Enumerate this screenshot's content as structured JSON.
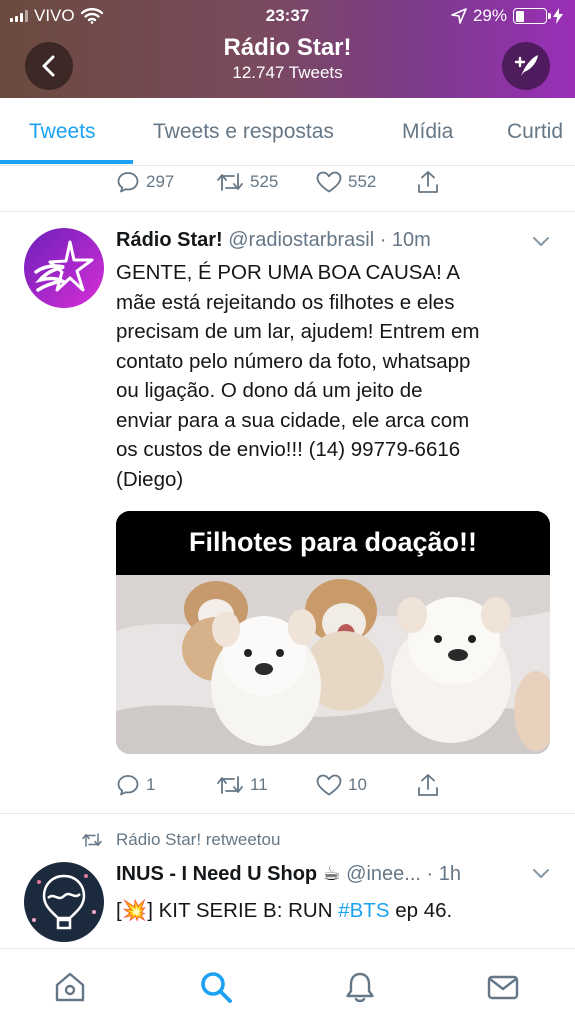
{
  "status": {
    "carrier": "VIVO",
    "time": "23:37",
    "battery": "29%"
  },
  "header": {
    "title": "Rádio Star!",
    "subtitle": "12.747 Tweets"
  },
  "tabs": [
    {
      "label": "Tweets"
    },
    {
      "label": "Tweets e respostas"
    },
    {
      "label": "Mídia"
    },
    {
      "label": "Curtid"
    }
  ],
  "prev_tweet": {
    "replies": "297",
    "retweets": "525",
    "likes": "552"
  },
  "tweet": {
    "name": "Rádio Star!",
    "meta": "@radiostarbrasil · 10m",
    "text_lines": [
      "GENTE, É POR UMA BOA CAUSA! A",
      "mãe está rejeitando os filhotes e eles",
      "precisam de um lar, ajudem! Entrem em",
      "contato pelo número da foto, whatsapp",
      "ou ligação. O dono dá um jeito de",
      "enviar para a sua cidade, ele arca com",
      "os custos de envio!!! (14) 99779-6616",
      "(Diego)"
    ],
    "image_caption": "Filhotes para doação!!",
    "replies": "1",
    "retweets": "11",
    "likes": "10"
  },
  "retweet": {
    "retweeted_by": "Rádio Star! retweetou",
    "name": "INUS - I Need U Shop ☕",
    "meta": "@inee... · 1h",
    "text_prefix": "[💥] KIT SERIE B: RUN ",
    "hashtag": "#BTS",
    "text_suffix": " ep 46."
  },
  "colors": {
    "accent": "#1da1f2",
    "muted": "#657786",
    "header_gradient_end": "#9a2fb8"
  },
  "icons": [
    "back-icon",
    "compose-icon",
    "reply-icon",
    "retweet-icon",
    "like-icon",
    "share-icon",
    "chevron-down-icon",
    "home-icon",
    "search-icon",
    "bell-icon",
    "mail-icon"
  ]
}
